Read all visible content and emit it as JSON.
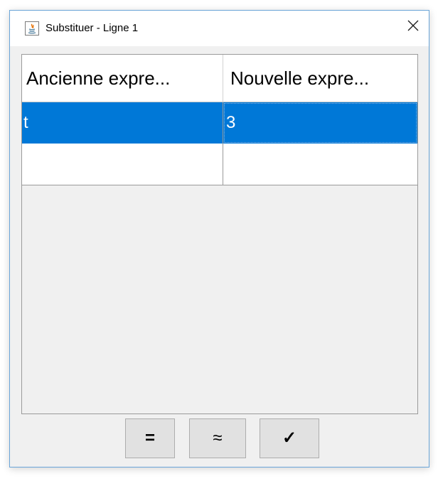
{
  "window": {
    "title": "Substituer - Ligne 1",
    "app_icon": "java-icon",
    "close_icon": "close-icon"
  },
  "table": {
    "columns": [
      "Ancienne expre...",
      "Nouvelle expre..."
    ],
    "rows": [
      {
        "old": "t",
        "new": "3",
        "selected": true
      },
      {
        "old": "",
        "new": "",
        "selected": false
      }
    ]
  },
  "buttons": {
    "equals_label": "=",
    "approx_label": "≈",
    "confirm_label": "✓"
  },
  "colors": {
    "selection": "#0078d7",
    "window_border": "#6aa5d8",
    "panel_bg": "#f0f0f0"
  }
}
